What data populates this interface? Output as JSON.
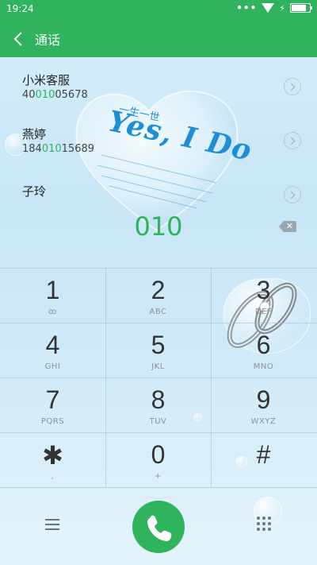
{
  "statusbar": {
    "time": "19:24",
    "signal_dots": "•••"
  },
  "header": {
    "title": "通话"
  },
  "wallpaper": {
    "heart_text_small": "一生一世",
    "heart_text_large": "Yes, I Do"
  },
  "contacts": [
    {
      "name": "小米客服",
      "number_prefix": "40",
      "number_match": "010",
      "number_suffix": "05678"
    },
    {
      "name": "燕婷",
      "number_prefix": "184",
      "number_match": "010",
      "number_suffix": "15689"
    },
    {
      "name": "子玲",
      "number_prefix": "",
      "number_match": "",
      "number_suffix": ""
    }
  ],
  "dialer": {
    "entered": "010"
  },
  "keys": [
    {
      "digit": "1",
      "sub": "ꝏ"
    },
    {
      "digit": "2",
      "sub": "ABC"
    },
    {
      "digit": "3",
      "sub": "DEF"
    },
    {
      "digit": "4",
      "sub": "GHI"
    },
    {
      "digit": "5",
      "sub": "JKL"
    },
    {
      "digit": "6",
      "sub": "MNO"
    },
    {
      "digit": "7",
      "sub": "PQRS"
    },
    {
      "digit": "8",
      "sub": "TUV"
    },
    {
      "digit": "9",
      "sub": "WXYZ"
    },
    {
      "digit": "✱",
      "sub": ","
    },
    {
      "digit": "0",
      "sub": "+"
    },
    {
      "digit": "#",
      "sub": ""
    }
  ],
  "colors": {
    "accent": "#2fb35d"
  },
  "icons": {
    "back": "chevron-left-icon",
    "backspace": "backspace-icon",
    "call": "phone-icon",
    "menu": "hamburger-icon",
    "keypad": "dialpad-icon"
  }
}
